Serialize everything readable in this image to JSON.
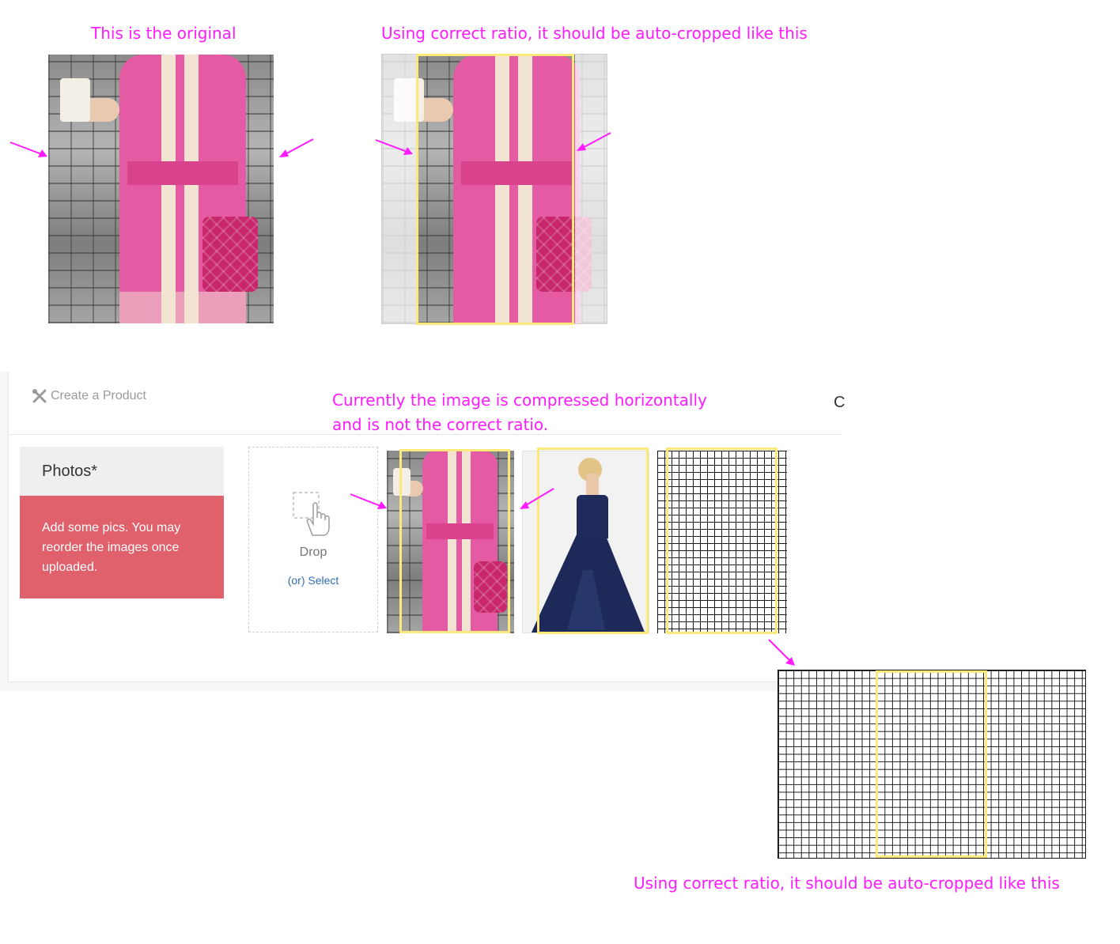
{
  "annotations": {
    "original_label": "This is the original",
    "crop_label_top": "Using correct ratio, it should be auto-cropped like this",
    "compressed_line1": "Currently the image is compressed horizontally",
    "compressed_line2": "and is not the correct ratio.",
    "crop_label_bottom": "Using correct ratio, it should be auto-cropped like this"
  },
  "header": {
    "breadcrumb_icon": "tools-icon",
    "breadcrumb": "Create a Product",
    "cut_off_text": "C"
  },
  "photos_card": {
    "title": "Photos*",
    "message": "Add some pics. You may reorder the images once uploaded."
  },
  "dropzone": {
    "icon": "hand-pointer-icon",
    "label": "Drop",
    "select_link": "(or) Select"
  },
  "thumbnails": [
    {
      "name": "pink-dress-image"
    },
    {
      "name": "navy-gown-image"
    },
    {
      "name": "grid-image"
    }
  ],
  "colors": {
    "annotation": "#ff1aff",
    "highlight": "#fde97a",
    "alert": "#e0606b",
    "link": "#2f6fb3"
  }
}
